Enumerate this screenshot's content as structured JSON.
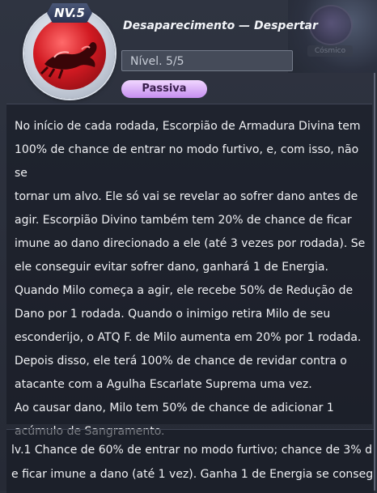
{
  "skill": {
    "level_badge": "NV.5",
    "title": "Desaparecimento — Despertar",
    "level": "Nível. 5/5",
    "type": "Passiva",
    "icon": "scorpion-icon"
  },
  "background": {
    "badge_label": "Cósmico"
  },
  "description": "No início de cada rodada, Escorpião de Armadura Divina tem\n100% de chance de entrar no modo furtivo, e, com isso, não se\ntornar um alvo. Ele só vai se revelar ao sofrer dano antes de\nagir. Escorpião Divino também tem 20% de chance de ficar\nimune ao dano direcionado a ele (até 3 vezes por rodada). Se\nele conseguir evitar sofrer dano, ganhará 1 de Energia.\nQuando Milo começa a agir, ele recebe 50% de Redução de\nDano por 1 rodada. Quando o inimigo retira Milo de seu\nesconderijo, o ATQ F. de Milo aumenta em 20% por 1 rodada.\nDepois disso, ele terá 100% de chance de revidar contra o\natacante com a Agulha Escarlate Suprema uma vez.\nAo causar dano, Milo tem 50% de chance de adicionar 1\nacúmulo de Sangramento.",
  "levels": {
    "line1": "lv.1 Chance de 60% de entrar no modo furtivo; chance de 3% d",
    "line2": "e ficar imune a dano (até 1 vez). Ganha 1 de Energia se conseg"
  },
  "colors": {
    "accent_passive": "#d6a4f7",
    "icon_red": "#d21a22"
  }
}
